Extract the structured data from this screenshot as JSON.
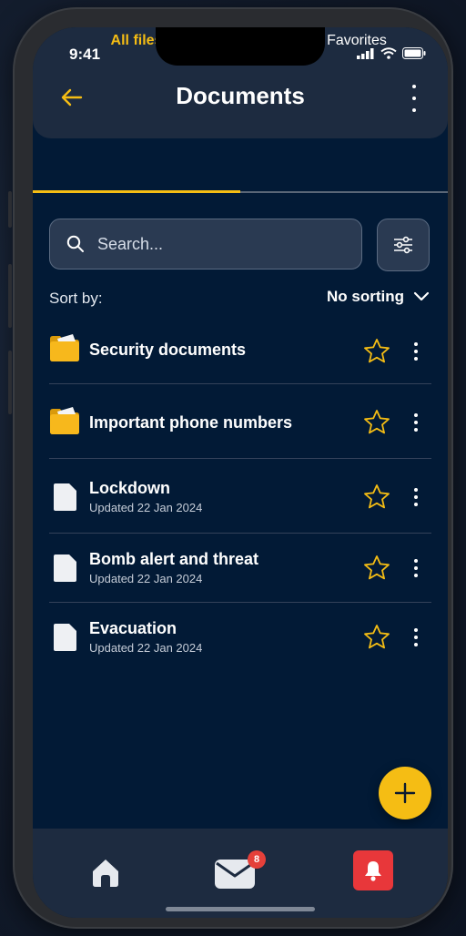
{
  "status_bar": {
    "time": "9:41"
  },
  "header": {
    "title": "Documents",
    "back_icon": "arrow-left-icon",
    "more_icon": "more-vertical-icon"
  },
  "tabs": [
    {
      "label": "All files",
      "active": true
    },
    {
      "label": "Favorites",
      "icon": "star-filled-icon",
      "active": false
    }
  ],
  "search": {
    "placeholder": "Search..."
  },
  "sort": {
    "label": "Sort by:",
    "value": "No sorting"
  },
  "items": [
    {
      "type": "folder",
      "name": "Security documents",
      "updated": ""
    },
    {
      "type": "folder",
      "name": "Important phone numbers",
      "updated": ""
    },
    {
      "type": "file",
      "name": "Lockdown",
      "updated": "Updated 22 Jan 2024"
    },
    {
      "type": "file",
      "name": "Bomb alert and threat",
      "updated": "Updated 22 Jan 2024"
    },
    {
      "type": "file",
      "name": "Evacuation",
      "updated": "Updated 22 Jan 2024"
    }
  ],
  "bottom_nav": {
    "mail_badge": "8"
  },
  "colors": {
    "accent": "#f5bd14",
    "background": "#021a36",
    "surface": "#1d2b40",
    "alert": "#e8373a"
  }
}
